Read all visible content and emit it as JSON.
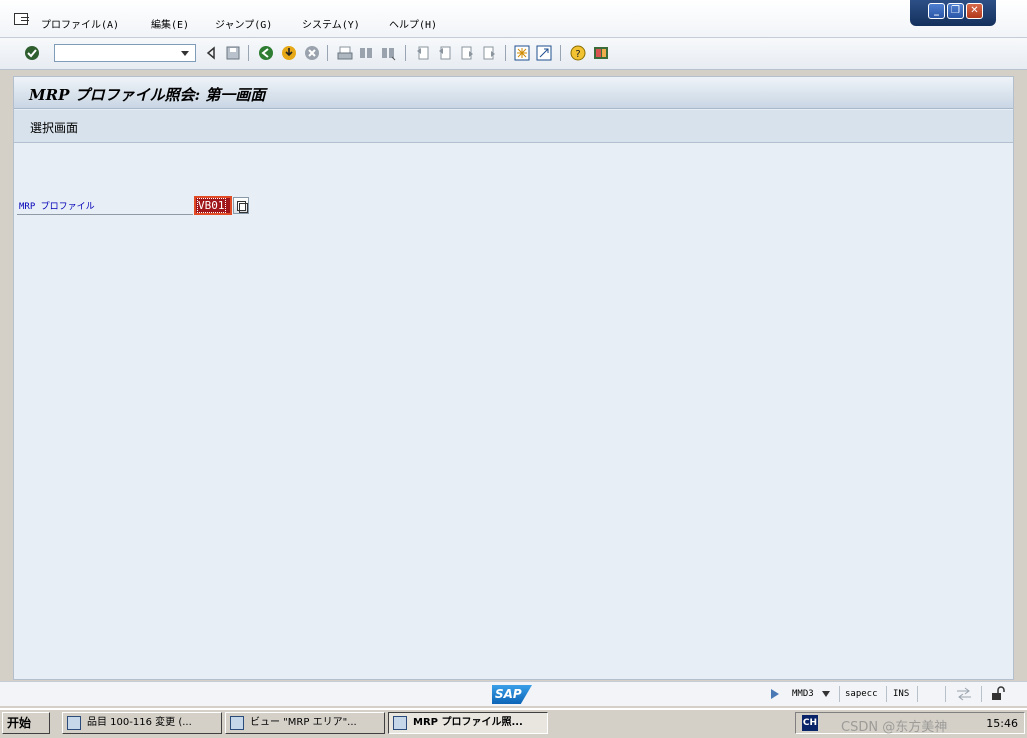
{
  "menu": {
    "items": [
      {
        "label": "プロファイル(A)"
      },
      {
        "label": "編集(E)"
      },
      {
        "label": "ジャンプ(G)"
      },
      {
        "label": "システム(Y)"
      },
      {
        "label": "ヘルプ(H)"
      }
    ]
  },
  "window_controls": {
    "minimize": "_",
    "restore": "❐",
    "close": "✕"
  },
  "toolbar": {
    "command_value": "",
    "icons": [
      "enter-icon",
      "back-icon",
      "exit-icon",
      "cancel-icon",
      "save-icon",
      "print-icon",
      "find-icon",
      "find-next-icon",
      "first-page-icon",
      "previous-page-icon",
      "next-page-icon",
      "last-page-icon",
      "new-session-icon",
      "shortcut-icon",
      "help-icon",
      "layout-icon"
    ]
  },
  "screen": {
    "title": "MRP プロファイル照会: 第一画面",
    "app_toolbar_button": "選択画面",
    "field_label": "MRP プロファイル",
    "field_value": "VB01"
  },
  "statusbar": {
    "logo": "SAP",
    "transaction": "MMD3",
    "server": "sapecc",
    "mode": "INS"
  },
  "taskbar": {
    "start": "开始",
    "tasks": [
      {
        "label": "品目 100-116 変更 (..."
      },
      {
        "label": "ビュー \"MRP エリア\"..."
      },
      {
        "label": "MRP プロファイル照..."
      }
    ],
    "ime": "CH",
    "watermark": "CSDN @东方美神",
    "clock": "15:46"
  },
  "colors": {
    "accent": "#a1161a",
    "label_blue": "#0000b8",
    "background": "#e8eef5"
  }
}
